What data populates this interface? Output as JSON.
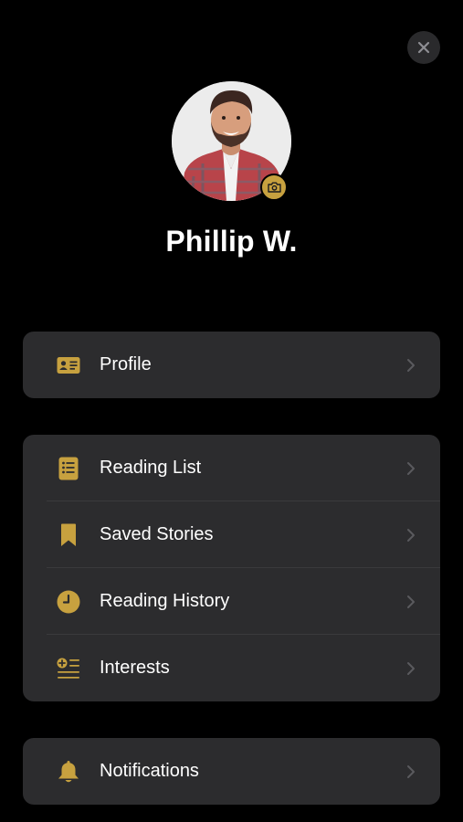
{
  "user": {
    "name": "Phillip W."
  },
  "colors": {
    "accent": "#C7A13F",
    "background": "#000000",
    "card": "#2C2C2E"
  },
  "menu_groups": [
    {
      "items": [
        {
          "label": "Profile",
          "icon": "id-card-icon"
        }
      ]
    },
    {
      "items": [
        {
          "label": "Reading List",
          "icon": "list-icon"
        },
        {
          "label": "Saved Stories",
          "icon": "bookmark-icon"
        },
        {
          "label": "Reading History",
          "icon": "clock-icon"
        },
        {
          "label": "Interests",
          "icon": "add-interests-icon"
        }
      ]
    },
    {
      "items": [
        {
          "label": "Notifications",
          "icon": "bell-icon"
        }
      ]
    }
  ]
}
